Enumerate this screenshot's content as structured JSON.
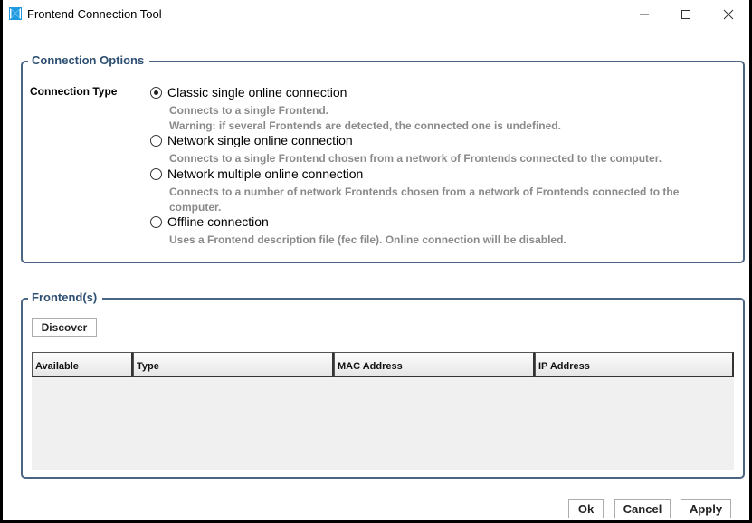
{
  "window": {
    "title": "Frontend Connection Tool",
    "app_icon": "app-logo-icon",
    "controls": [
      "minimize-icon",
      "maximize-icon",
      "close-icon"
    ]
  },
  "connection_options": {
    "group_title": "Connection Options",
    "label": "Connection Type",
    "options": [
      {
        "label": "Classic single online connection",
        "selected": true,
        "description": "Connects to a single Frontend.\nWarning: if several Frontends are detected, the connected one is undefined."
      },
      {
        "label": "Network single online connection",
        "selected": false,
        "description": "Connects to a single Frontend chosen from a network of Frontends connected to the computer."
      },
      {
        "label": "Network multiple online connection",
        "selected": false,
        "description": "Connects to a number of network Frontends chosen from a network of Frontends connected to the computer."
      },
      {
        "label": "Offline connection",
        "selected": false,
        "description": "Uses a Frontend description file (fec file). Online connection will be disabled."
      }
    ]
  },
  "frontends": {
    "group_title": "Frontend(s)",
    "discover_label": "Discover",
    "columns": [
      "Available",
      "Type",
      "MAC Address",
      "IP Address"
    ],
    "rows": []
  },
  "footer": {
    "ok_label": "Ok",
    "cancel_label": "Cancel",
    "apply_label": "Apply"
  }
}
